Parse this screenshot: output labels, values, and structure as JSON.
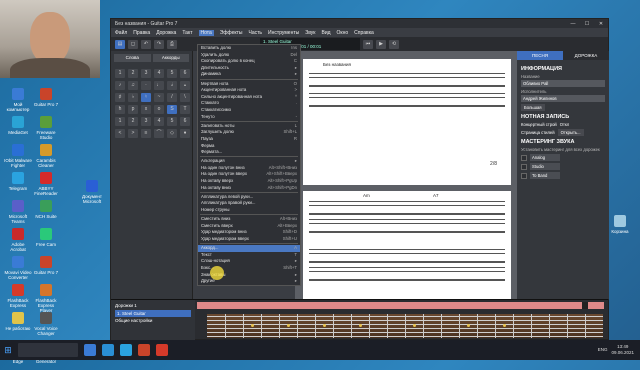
{
  "window": {
    "title": "Без названия - Guitar Pro 7",
    "controls": [
      "—",
      "☐",
      "✕"
    ]
  },
  "menubar": [
    "Файл",
    "Правка",
    "Дорожка",
    "Такт",
    "Нота",
    "Эффекты",
    "Часть",
    "Инструменты",
    "Звук",
    "Вид",
    "Окно",
    "Справка"
  ],
  "menubar_active": "Нота",
  "toolbar": {
    "track_name": "1. Steel Guitar",
    "lcd_line2": "00/55   ♩4.0:4.0   01/01 / 00:01"
  },
  "left_panel": {
    "tabs": [
      "Слова",
      "Аккорды"
    ],
    "palette": [
      "1",
      "2",
      "3",
      "4",
      "5",
      "6",
      "♪",
      "♫",
      "·",
      "♩",
      "𝅗𝅥",
      "𝅝",
      "♯",
      "♭",
      "♮",
      "~",
      "/",
      "\\",
      "h",
      "p",
      "x",
      "o",
      "S",
      "T",
      "1",
      "2",
      "3",
      "4",
      "5",
      "6",
      "<",
      ">",
      "≡",
      "⌒",
      "◇",
      "♦"
    ]
  },
  "note_menu": {
    "items": [
      {
        "label": "Вставить долю",
        "shortcut": "Ins"
      },
      {
        "label": "Удалить долю",
        "shortcut": "Del"
      },
      {
        "label": "Скопировать долю в конец",
        "shortcut": "C"
      },
      {
        "label": "Длительность",
        "shortcut": "▸"
      },
      {
        "label": "Динамика",
        "shortcut": "▸"
      },
      {
        "sep": true
      },
      {
        "label": "Мертвая нота",
        "shortcut": "O"
      },
      {
        "label": "Акцентированная нота",
        "shortcut": ">"
      },
      {
        "label": "Сильно акцентированная нота",
        "shortcut": "^"
      },
      {
        "label": "Стаккато",
        "shortcut": "."
      },
      {
        "label": "Стаккатиссимо",
        "shortcut": ""
      },
      {
        "label": "Тенуто",
        "shortcut": "-"
      },
      {
        "sep": true
      },
      {
        "label": "Залиговать ноты",
        "shortcut": "L"
      },
      {
        "label": "Заглушить долю",
        "shortcut": "Shift+L"
      },
      {
        "label": "Пауза",
        "shortcut": "R"
      },
      {
        "label": "Ферма",
        "shortcut": ""
      },
      {
        "label": "Фермата...",
        "shortcut": ""
      },
      {
        "sep": true
      },
      {
        "label": "Альтерация",
        "shortcut": "▸"
      },
      {
        "label": "На один полутон вниз",
        "shortcut": "Alt+Shift+Вниз"
      },
      {
        "label": "На один полутон вверх",
        "shortcut": "Alt+Shift+Вверх"
      },
      {
        "label": "На октаву вверх",
        "shortcut": "Alt+Shift+PgUp"
      },
      {
        "label": "На октаву вниз",
        "shortcut": "Alt+Shift+PgDn"
      },
      {
        "sep": true
      },
      {
        "label": "Аппликатура левой руки...",
        "shortcut": ""
      },
      {
        "label": "Аппликатура правой руки...",
        "shortcut": ""
      },
      {
        "label": "Номер струны",
        "shortcut": ""
      },
      {
        "sep": true
      },
      {
        "label": "Сместить вниз",
        "shortcut": "Alt+Вниз"
      },
      {
        "label": "Сместить вверх",
        "shortcut": "Alt+Вверх"
      },
      {
        "label": "Удар медиатором вниз",
        "shortcut": "Shift+D"
      },
      {
        "label": "Удар медиатором вверх",
        "shortcut": "Shift+U"
      },
      {
        "sep": true
      },
      {
        "label": "Аккорд...",
        "shortcut": "A"
      },
      {
        "label": "Текст",
        "shortcut": "T"
      },
      {
        "label": "Слэш-нотация",
        "shortcut": "▸"
      },
      {
        "label": "Бэкс...",
        "shortcut": "Shift+T"
      },
      {
        "label": "Знак октавы",
        "shortcut": "▸"
      },
      {
        "label": "Другие",
        "shortcut": "▸"
      }
    ],
    "selected_index": 34
  },
  "score": {
    "title": "Без названия",
    "page_number": "2/8",
    "chord_labels": [
      "Am",
      "A7"
    ]
  },
  "right_panel": {
    "tabs": [
      "ПЕСНЯ",
      "ДОРОЖКА"
    ],
    "info_heading": "ИНФОРМАЦИЯ",
    "title_label": "Название",
    "title_value": "Обливио Pall",
    "artist_label": "Исполнитель",
    "artist_value": "Андрей Жилинов",
    "notes_heading": "НОТНАЯ ЗАПИСЬ",
    "concert_label": "Концертный строй",
    "concert_state": "Откл",
    "page_style_label": "Страница стилей",
    "open_label": "Открыть...",
    "size_label": "Большая",
    "mastering_heading": "МАСТЕРИНГ ЗВУКА",
    "mastering_desc": "Установить мастеринг для всех дорожек",
    "effects": [
      "Analog",
      "Studio",
      "To Band"
    ]
  },
  "bottom_panel": {
    "tracks_label": "Дорожки  1",
    "track_name": "1. Steel Guitar",
    "settings_label": "Общие настройки"
  },
  "desktop_icons": [
    {
      "label": "Мой компьютер",
      "color": "#3a7bd5"
    },
    {
      "label": "Guitar Pro 7",
      "color": "#c9442a"
    },
    {
      "label": "MediaGet",
      "color": "#2aa3d5"
    },
    {
      "label": "Freeware Studio",
      "color": "#5a9e3a"
    },
    {
      "label": "IObit Malware Fighter",
      "color": "#2a6fd5"
    },
    {
      "label": "Carambis Cleaner",
      "color": "#d59a2a"
    },
    {
      "label": "Telegram",
      "color": "#2aa3e0"
    },
    {
      "label": "ABBYY FineReader",
      "color": "#d52a2a"
    },
    {
      "label": "Microsoft Teams",
      "color": "#5a5fc9"
    },
    {
      "label": "NCH Suite",
      "color": "#3a9e5a"
    },
    {
      "label": "Adobe Acrobat",
      "color": "#c92a2a"
    },
    {
      "label": "Free Cam",
      "color": "#2ac97a"
    },
    {
      "label": "Movavi Video Converter",
      "color": "#3a7bd5"
    },
    {
      "label": "Guitar Pro 7",
      "color": "#c9442a"
    },
    {
      "label": "FlashBack Express",
      "color": "#d53a2a"
    },
    {
      "label": "FlashBack Express Player",
      "color": "#d5752a"
    },
    {
      "label": "Не работаю",
      "color": "#e0c44a"
    },
    {
      "label": "Vocal Voice Changer",
      "color": "#555"
    },
    {
      "label": "Microsoft Edge",
      "color": "#2a8fd5"
    },
    {
      "label": "NCH Tone Generator",
      "color": "#3a9e5a"
    },
    {
      "label": "Документ Microsoft",
      "color": "#2a5fd5"
    },
    {
      "label": "Корзина",
      "color": "#9ec9e0"
    }
  ],
  "taskbar": {
    "tray_lang": "ENG",
    "time": "13:49",
    "date": "09.06.2021"
  }
}
